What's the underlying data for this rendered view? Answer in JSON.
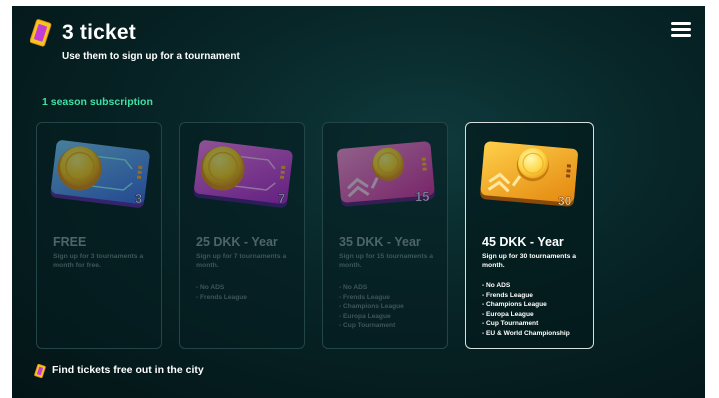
{
  "header": {
    "title": "3 ticket",
    "subtitle": "Use them to sign up for a tournament"
  },
  "section": {
    "label": "1 season subscription"
  },
  "plans": [
    {
      "price": "FREE",
      "description": "Sign up for 3 tournaments a month for free.",
      "ticket_number": "3",
      "ticket_color": "blue",
      "features": [],
      "selected": false
    },
    {
      "price": "25 DKK - Year",
      "description": "Sign up for 7 tournaments a month.",
      "ticket_number": "7",
      "ticket_color": "magenta",
      "features": [
        "- No ADS",
        "- Frends League"
      ],
      "selected": false
    },
    {
      "price": "35 DKK - Year",
      "description": "Sign up for 15 tournaments a month.",
      "ticket_number": "15",
      "ticket_color": "pink",
      "features": [
        "- No ADS",
        "- Frends League",
        "- Champions League",
        "- Europa League",
        "- Cup Tournament"
      ],
      "selected": false
    },
    {
      "price": "45 DKK - Year",
      "description": "Sign up for 30 tournaments a month.",
      "ticket_number": "30",
      "ticket_color": "gold",
      "features": [
        "- No ADS",
        "- Frends League",
        "- Champions League",
        "- Europa League",
        "- Cup Tournament",
        "- EU & World Championship"
      ],
      "selected": true
    }
  ],
  "footer": {
    "text": "Find tickets free out in the city"
  },
  "colors": {
    "background": "#072426",
    "accent_green": "#3fe0a5",
    "ticket_blue": "#3b8bff",
    "ticket_magenta": "#c61fd6",
    "ticket_pink": "#e63fb5",
    "ticket_gold": "#f2a21a",
    "coin": "#ffd21f"
  },
  "icons": {
    "header": "ticket-icon",
    "menu": "hamburger-menu-icon",
    "footer": "ticket-icon"
  }
}
